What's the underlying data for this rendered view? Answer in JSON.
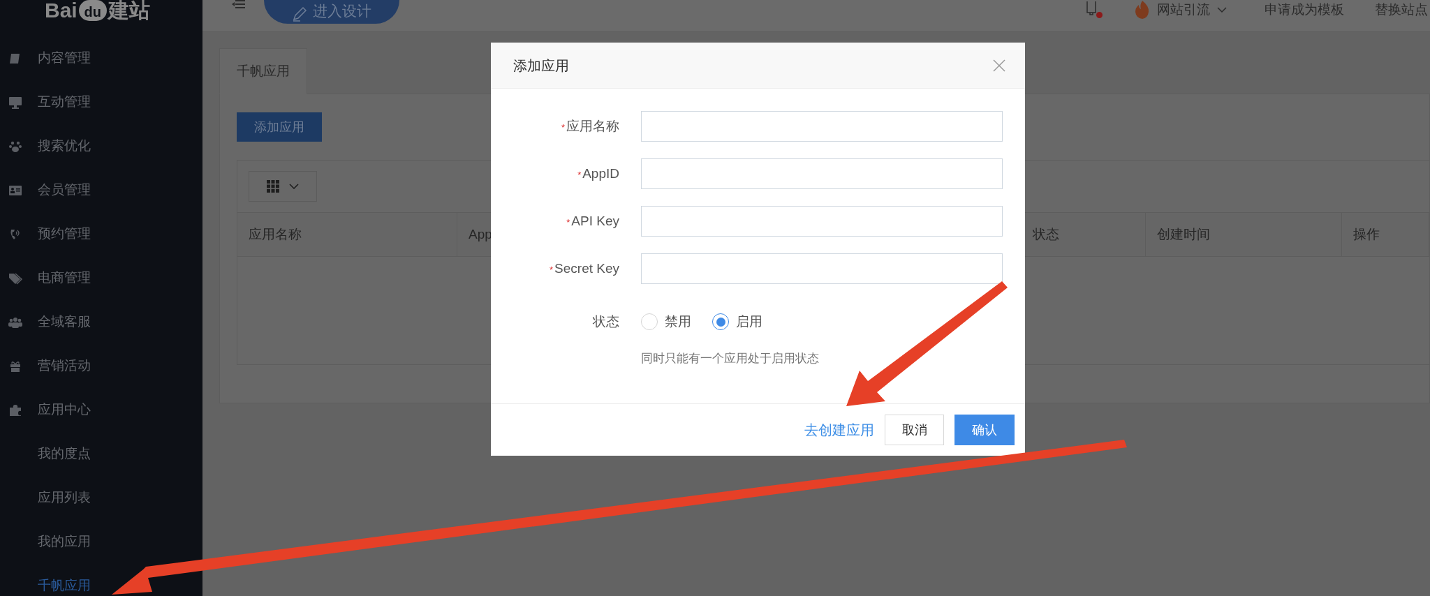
{
  "logo": {
    "parts": [
      "Bai",
      "du",
      "建站"
    ]
  },
  "sidebar": {
    "items": [
      {
        "label": "内容管理",
        "selected": false
      },
      {
        "label": "互动管理",
        "selected": false
      },
      {
        "label": "搜索优化",
        "selected": false
      },
      {
        "label": "会员管理",
        "selected": false
      },
      {
        "label": "预约管理",
        "selected": false
      },
      {
        "label": "电商管理",
        "selected": false
      },
      {
        "label": "全域客服",
        "selected": false
      },
      {
        "label": "营销活动",
        "selected": false
      },
      {
        "label": "应用中心",
        "selected": false,
        "children": [
          {
            "label": "我的度点",
            "selected": false
          },
          {
            "label": "应用列表",
            "selected": false
          },
          {
            "label": "我的应用",
            "selected": false
          },
          {
            "label": "千帆应用",
            "selected": true
          }
        ]
      }
    ]
  },
  "topbar": {
    "design_button": "进入设计",
    "has_notification": true,
    "traffic_menu": "网站引流",
    "links": [
      "申请成为模板",
      "替换站点"
    ]
  },
  "tabs": [
    {
      "label": "千帆应用",
      "selected": true
    }
  ],
  "add_button": "添加应用",
  "table": {
    "columns": [
      "应用名称",
      "App",
      "状态",
      "创建时间",
      "操作"
    ]
  },
  "dialog": {
    "title": "添加应用",
    "fields": [
      {
        "label": "应用名称",
        "required_mark": "*"
      },
      {
        "label": "AppID",
        "required_mark": "*"
      },
      {
        "label": "API Key",
        "required_mark": "*"
      },
      {
        "label": "Secret Key",
        "required_mark": "*"
      }
    ],
    "status": {
      "label": "状态",
      "options": [
        {
          "label": "禁用",
          "selected": false
        },
        {
          "label": "启用",
          "selected": true
        }
      ],
      "hint": "同时只能有一个应用处于启用状态"
    },
    "link": "去创建应用",
    "cancel": "取消",
    "confirm": "确认"
  }
}
